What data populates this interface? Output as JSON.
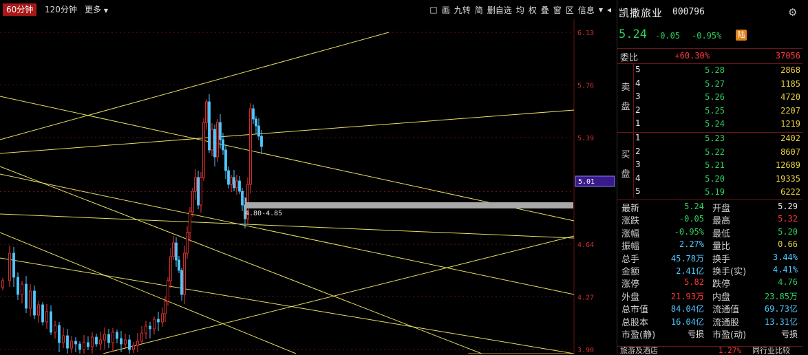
{
  "toolbar": {
    "timeframes": [
      "60分钟",
      "120分钟",
      "更多"
    ],
    "active_timeframe": "60分钟",
    "more_arrow": "▼",
    "tools": [
      "□",
      "画",
      "九转",
      "简",
      "删自选",
      "均",
      "权",
      "叠",
      "窗",
      "区",
      "信息",
      "▼",
      "◂"
    ]
  },
  "chart": {
    "price_levels": [
      "6.13",
      "5.76",
      "5.39",
      "5.01",
      "4.64",
      "4.27",
      "3.90"
    ],
    "current_price_tag": "5.01",
    "zone_label": "4.80-4.85"
  },
  "stock": {
    "name": "凯撒旅业",
    "code": "000796",
    "price": "5.24",
    "change": "-0.05",
    "change_pct": "-0.95%",
    "badge": "陆"
  },
  "ratio": {
    "label": "委比",
    "pct": "+60.30%",
    "diff": "37056"
  },
  "sell_label": "卖盘",
  "buy_label": "买盘",
  "asks": [
    {
      "level": "5",
      "price": "5.28",
      "vol": "2868"
    },
    {
      "level": "4",
      "price": "5.27",
      "vol": "1185"
    },
    {
      "level": "3",
      "price": "5.26",
      "vol": "4720"
    },
    {
      "level": "2",
      "price": "5.25",
      "vol": "2207"
    },
    {
      "level": "1",
      "price": "5.24",
      "vol": "1219"
    }
  ],
  "bids": [
    {
      "level": "1",
      "price": "5.23",
      "vol": "2402"
    },
    {
      "level": "2",
      "price": "5.22",
      "vol": "8607"
    },
    {
      "level": "3",
      "price": "5.21",
      "vol": "12689"
    },
    {
      "level": "4",
      "price": "5.20",
      "vol": "19335"
    },
    {
      "level": "5",
      "price": "5.19",
      "vol": "6222"
    }
  ],
  "stats": [
    {
      "l1": "最新",
      "v1": "5.24",
      "c1": "green",
      "l2": "开盘",
      "v2": "5.29",
      "c2": "white"
    },
    {
      "l1": "涨跌",
      "v1": "-0.05",
      "c1": "green",
      "l2": "最高",
      "v2": "5.32",
      "c2": "red"
    },
    {
      "l1": "涨幅",
      "v1": "-0.95%",
      "c1": "green",
      "l2": "最低",
      "v2": "5.20",
      "c2": "green"
    },
    {
      "l1": "振幅",
      "v1": "2.27%",
      "c1": "cyan",
      "l2": "量比",
      "v2": "0.66",
      "c2": "yellow"
    },
    {
      "l1": "总手",
      "v1": "45.78万",
      "c1": "cyan",
      "l2": "换手",
      "v2": "3.44%",
      "c2": "cyan"
    },
    {
      "l1": "金额",
      "v1": "2.41亿",
      "c1": "cyan",
      "l2": "换手(实)",
      "v2": "4.41%",
      "c2": "cyan"
    },
    {
      "l1": "涨停",
      "v1": "5.82",
      "c1": "red",
      "l2": "跌停",
      "v2": "4.76",
      "c2": "green"
    },
    {
      "l1": "外盘",
      "v1": "21.93万",
      "c1": "red",
      "l2": "内盘",
      "v2": "23.85万",
      "c2": "green"
    },
    {
      "l1": "总市值",
      "v1": "84.04亿",
      "c1": "cyan",
      "l2": "流通值",
      "v2": "69.73亿",
      "c2": "cyan"
    },
    {
      "l1": "总股本",
      "v1": "16.04亿",
      "c1": "cyan",
      "l2": "流通股",
      "v2": "13.31亿",
      "c2": "cyan"
    },
    {
      "l1": "市盈(静)",
      "v1": "亏损",
      "c1": "white",
      "l2": "市盈(动)",
      "v2": "亏损",
      "c2": "white"
    }
  ],
  "footer": {
    "industry": "旅游及酒店",
    "industry_pct": "1.27%",
    "compare": "同行业比较"
  },
  "colors": {
    "up": "#ff3838",
    "down": "#2cd05c",
    "grid": "#6a1515",
    "trendline": "#e8e060"
  }
}
